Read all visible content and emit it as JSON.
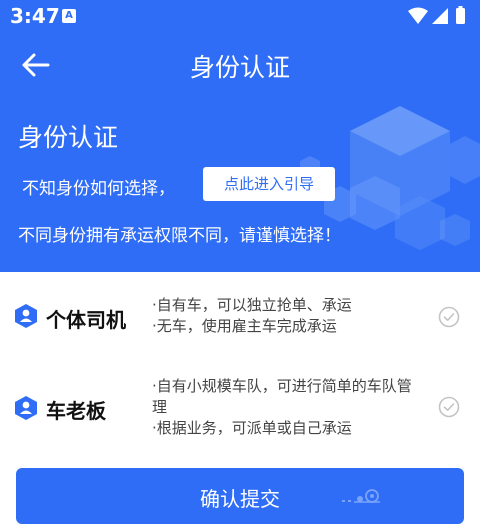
{
  "status_bar": {
    "time": "3:47",
    "notification_badge": "A"
  },
  "app_bar": {
    "title": "身份认证"
  },
  "banner": {
    "title": "身份认证",
    "question": "不知身份如何选择，",
    "guide_button": "点此进入引导",
    "note": "不同身份拥有承运权限不同，请谨慎选择！"
  },
  "roles": [
    {
      "name": "个体司机",
      "desc": [
        "·自有车，可以独立抢单、承运",
        "·无车，使用雇主车完成承运"
      ]
    },
    {
      "name": "车老板",
      "desc": [
        "·自有小规模车队，可进行简单的车队管",
        "  理",
        "·根据业务，可派单或自己承运"
      ]
    }
  ],
  "submit_button": {
    "label": "确认提交"
  },
  "colors": {
    "primary": "#2f6df6",
    "check_gray": "#c4c4c4"
  }
}
